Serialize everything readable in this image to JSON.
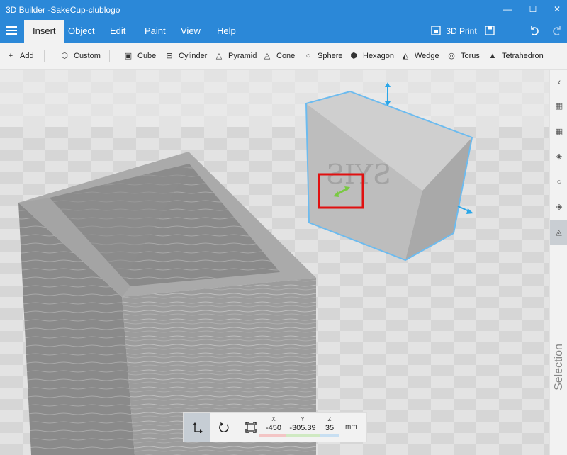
{
  "window": {
    "title": "3D Builder -SakeCup-clublogo",
    "controls": {
      "minimize": "—",
      "maximize": "☐",
      "close": "✕"
    }
  },
  "menu": {
    "tabs": [
      "Insert",
      "Object",
      "Edit",
      "Paint",
      "View",
      "Help"
    ],
    "print_label": "3D Print"
  },
  "toolbar": {
    "add_label": "Add",
    "custom_label": "Custom",
    "shapes": [
      "Cube",
      "Cylinder",
      "Pyramid",
      "Cone",
      "Sphere",
      "Hexagon",
      "Wedge",
      "Torus",
      "Tetrahedron"
    ]
  },
  "right_panel": {
    "selection_label": "Selection"
  },
  "coords": {
    "x_label": "X",
    "y_label": "Y",
    "z_label": "Z",
    "x": "-450",
    "y": "-305.39",
    "z": "35",
    "unit": "mm"
  },
  "scene": {
    "engraved_text": "SYIS"
  },
  "colors": {
    "accent": "#2b88d8",
    "selection_outline": "#6cbbef",
    "highlight_box": "#e01010",
    "handle": "#2aa6e8"
  }
}
